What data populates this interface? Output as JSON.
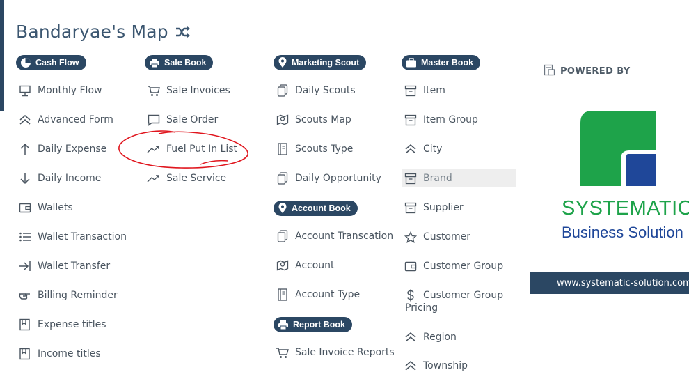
{
  "title": "Bandaryae's Map",
  "sections": {
    "cash_flow": {
      "label": "Cash Flow",
      "items": [
        {
          "label": "Monthly Flow",
          "icon": "presentation-icon"
        },
        {
          "label": "Advanced Form",
          "icon": "double-chevron-up-icon"
        },
        {
          "label": "Daily Expense",
          "icon": "arrow-up-icon"
        },
        {
          "label": "Daily Income",
          "icon": "arrow-down-icon"
        },
        {
          "label": "Wallets",
          "icon": "wallet-icon"
        },
        {
          "label": "Wallet Transaction",
          "icon": "list-icon"
        },
        {
          "label": "Wallet Transfer",
          "icon": "arrow-to-line-icon"
        },
        {
          "label": "Billing Reminder",
          "icon": "hand-point-icon"
        },
        {
          "label": "Expense titles",
          "icon": "bookmark-book-icon"
        },
        {
          "label": "Income titles",
          "icon": "bookmark-book-icon"
        }
      ]
    },
    "sale_book": {
      "label": "Sale Book",
      "items": [
        {
          "label": "Sale Invoices",
          "icon": "cart-icon"
        },
        {
          "label": "Sale Order",
          "icon": "chat-icon"
        },
        {
          "label": "Fuel Put In List",
          "icon": "trend-up-icon"
        },
        {
          "label": "Sale Service",
          "icon": "trend-up-icon"
        }
      ]
    },
    "marketing_scout": {
      "label": "Marketing Scout",
      "items": [
        {
          "label": "Daily Scouts",
          "icon": "copy-icon"
        },
        {
          "label": "Scouts Map",
          "icon": "map-pin-icon"
        },
        {
          "label": "Scouts Type",
          "icon": "document-icon"
        },
        {
          "label": "Daily Opportunity",
          "icon": "copy-icon"
        }
      ]
    },
    "account_book": {
      "label": "Account Book",
      "items": [
        {
          "label": "Account Transcation",
          "icon": "copy-icon"
        },
        {
          "label": "Account",
          "icon": "map-pin-icon"
        },
        {
          "label": "Account Type",
          "icon": "document-icon"
        }
      ]
    },
    "report_book": {
      "label": "Report Book",
      "items": [
        {
          "label": "Sale Invoice Reports",
          "icon": "cart-icon"
        }
      ]
    },
    "master_book": {
      "label": "Master Book",
      "items": [
        {
          "label": "Item",
          "icon": "archive-icon"
        },
        {
          "label": "Item Group",
          "icon": "archive-icon"
        },
        {
          "label": "City",
          "icon": "double-chevron-up-icon"
        },
        {
          "label": "Brand",
          "icon": "archive-icon"
        },
        {
          "label": "Supplier",
          "icon": "archive-icon"
        },
        {
          "label": "Customer",
          "icon": "star-icon"
        },
        {
          "label": "Customer Group",
          "icon": "wallet-icon"
        },
        {
          "label": "Customer Group",
          "label2": "Pricing",
          "icon": "dollar-icon"
        },
        {
          "label": "Region",
          "icon": "double-chevron-up-icon"
        },
        {
          "label": "Township",
          "icon": "double-chevron-up-icon"
        }
      ]
    }
  },
  "powered": {
    "label": "POWERED BY",
    "company_name": "SYSTEMATIC",
    "company_sub": "Business Solution",
    "website": "www.systematic-solution.com"
  },
  "colors": {
    "navy": "#2b4763",
    "green": "#1ea34a",
    "blue": "#1f4799",
    "annotation": "#e0161e"
  }
}
